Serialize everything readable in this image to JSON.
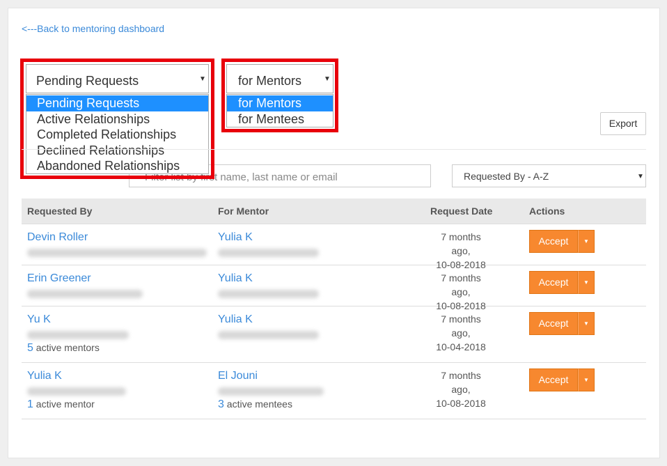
{
  "back_link": "<---Back to mentoring dashboard",
  "status_select": {
    "value": "Pending Requests",
    "options": [
      "Pending Requests",
      "Active Relationships",
      "Completed Relationships",
      "Declined Relationships",
      "Abandoned Relationships"
    ],
    "selected_index": 0
  },
  "role_select": {
    "value": "for Mentors",
    "options": [
      "for Mentors",
      "for Mentees"
    ],
    "selected_index": 0
  },
  "export_label": "Export",
  "filter": {
    "placeholder": "Filter list by first name, last name or email"
  },
  "sort_select": {
    "value": "Requested By - A-Z"
  },
  "table": {
    "headers": {
      "requested_by": "Requested By",
      "for_mentor": "For Mentor",
      "request_date": "Request Date",
      "actions": "Actions"
    },
    "rows": [
      {
        "requested_by": "Devin Roller",
        "mentor": "Yulia K",
        "date_rel": "7 months ago,",
        "date": "10-08-2018",
        "accept": "Accept"
      },
      {
        "requested_by": "Erin Greener",
        "mentor": "Yulia K",
        "date_rel": "7 months ago,",
        "date": "10-08-2018",
        "accept": "Accept"
      },
      {
        "requested_by": "Yu K",
        "mentor": "Yulia K",
        "date_rel": "7 months ago,",
        "date": "10-04-2018",
        "accept": "Accept",
        "req_count": "5",
        "req_count_label": "active mentors"
      },
      {
        "requested_by": "Yulia K",
        "mentor": "El Jouni",
        "date_rel": "7 months ago,",
        "date": "10-08-2018",
        "accept": "Accept",
        "req_count": "1",
        "req_count_label": "active mentor",
        "mentor_count": "3",
        "mentor_count_label": "active mentees"
      }
    ]
  },
  "colors": {
    "accent": "#f7882f",
    "link": "#3b8ad9",
    "highlight": "#e8000b",
    "selected": "#1e90ff"
  },
  "icons": {
    "dropdown": "caret-down-icon"
  }
}
